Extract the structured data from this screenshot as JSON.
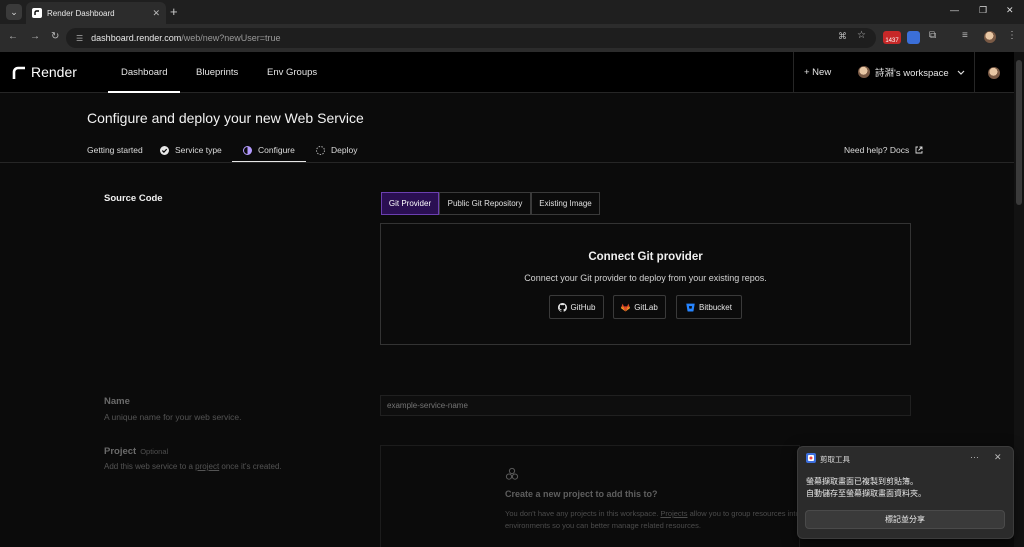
{
  "browser": {
    "tab_title": "Render Dashboard",
    "tab_close": "✕",
    "new_tab": "+",
    "url_host": "dashboard.render.com",
    "url_path": "/web/new?newUser=true",
    "extension_badge": "1437"
  },
  "nav": {
    "brand": "Render",
    "links": [
      "Dashboard",
      "Blueprints",
      "Env Groups"
    ],
    "new_label": "+ New",
    "workspace": "詩淵's workspace"
  },
  "page": {
    "title": "Configure and deploy your new Web Service",
    "steps": [
      "Getting started",
      "Service type",
      "Configure",
      "Deploy"
    ],
    "help": "Need help? Docs"
  },
  "source": {
    "label": "Source Code",
    "tabs": [
      "Git Provider",
      "Public Git Repository",
      "Existing Image"
    ],
    "connect_title": "Connect Git provider",
    "connect_sub": "Connect your Git provider to deploy from your existing repos.",
    "providers": [
      "GitHub",
      "GitLab",
      "Bitbucket"
    ]
  },
  "form": {
    "name_label": "Name",
    "name_help": "A unique name for your web service.",
    "name_placeholder": "example-service-name",
    "project_label": "Project",
    "project_optional": "Optional",
    "project_help_pre": "Add this web service to a ",
    "project_help_link": "project",
    "project_help_post": " once it's created.",
    "project_box_title": "Create a new project to add this to?",
    "project_box_pre": "You don't have any projects in this workspace. ",
    "project_box_link": "Projects",
    "project_box_post": " allow you to group resources into environments so you can better manage related resources."
  },
  "toast": {
    "app_name": "剪取工具",
    "more": "···",
    "close": "✕",
    "line1": "螢幕擷取畫面已複製到剪貼簿。",
    "line2": "自動儲存至螢幕擷取畫面資料夾。",
    "button": "標記並分享"
  },
  "colors": {
    "accent_purple": "#2a0f52",
    "background": "#0b0b0b"
  }
}
